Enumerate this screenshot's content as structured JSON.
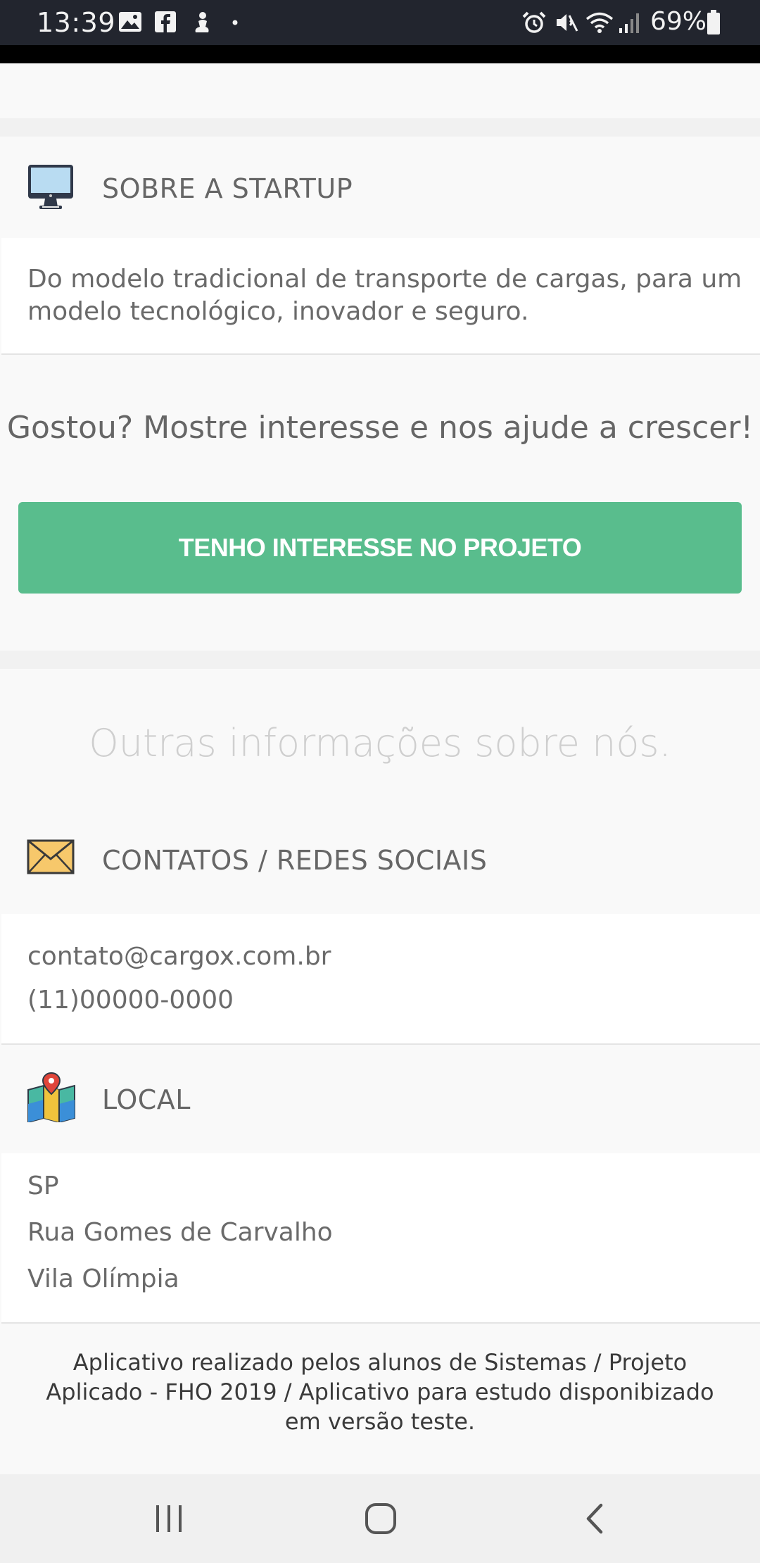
{
  "status_bar": {
    "time": "13:39",
    "battery": "69%",
    "icons": [
      "gallery-icon",
      "facebook-icon",
      "app-notification-icon",
      "dot-icon",
      "alarm-icon",
      "mute-icon",
      "wifi-icon",
      "signal-icon",
      "battery-icon"
    ]
  },
  "about": {
    "heading": "SOBRE A STARTUP",
    "icon": "computer-icon",
    "description_lines": [
      "Do modelo tradicional de transporte de cargas, para um",
      "modelo tecnológico, inovador e seguro."
    ]
  },
  "cta": {
    "prompt": "Gostou? Mostre interesse e nos ajude a crescer!",
    "button_label": "TENHO INTERESSE NO PROJETO",
    "button_color": "#59bd8d"
  },
  "other_info": {
    "title": "Outras informações sobre nós."
  },
  "contacts": {
    "heading": "CONTATOS / REDES SOCIAIS",
    "icon": "envelope-icon",
    "email": "contato@cargox.com.br",
    "phone": "(11)00000-0000"
  },
  "location": {
    "heading": "LOCAL",
    "icon": "map-icon",
    "lines": [
      "SP",
      "Rua Gomes de Carvalho",
      "Vila Olímpia"
    ]
  },
  "footer": {
    "text": "Aplicativo realizado pelos alunos de Sistemas / Projeto Aplicado - FHO 2019 / Aplicativo para estudo disponibizado em versão teste."
  },
  "nav_bar": {
    "buttons": [
      "recent-apps-icon",
      "home-icon",
      "back-icon"
    ]
  }
}
